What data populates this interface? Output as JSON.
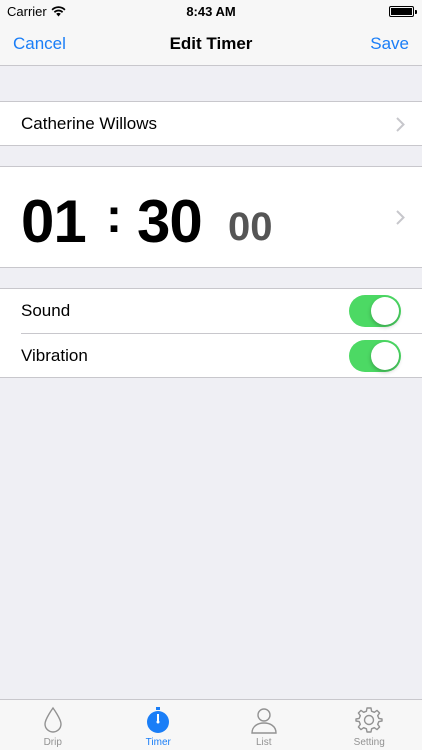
{
  "status": {
    "carrier": "Carrier",
    "time": "8:43 AM"
  },
  "nav": {
    "cancel": "Cancel",
    "title": "Edit Timer",
    "save": "Save"
  },
  "name_cell": {
    "label": "Catherine Willows"
  },
  "timer": {
    "hours": "01",
    "separator": ":",
    "minutes": "30",
    "seconds": "00"
  },
  "settings": [
    {
      "label": "Sound",
      "on": true
    },
    {
      "label": "Vibration",
      "on": true
    }
  ],
  "tabs": [
    {
      "label": "Drip",
      "icon": "drop-icon",
      "active": false
    },
    {
      "label": "Timer",
      "icon": "stopwatch-icon",
      "active": true
    },
    {
      "label": "List",
      "icon": "person-icon",
      "active": false
    },
    {
      "label": "Setting",
      "icon": "gear-icon",
      "active": false
    }
  ],
  "colors": {
    "accent": "#1a7ef7",
    "toggle_on": "#4cd964",
    "background": "#efeff4"
  }
}
